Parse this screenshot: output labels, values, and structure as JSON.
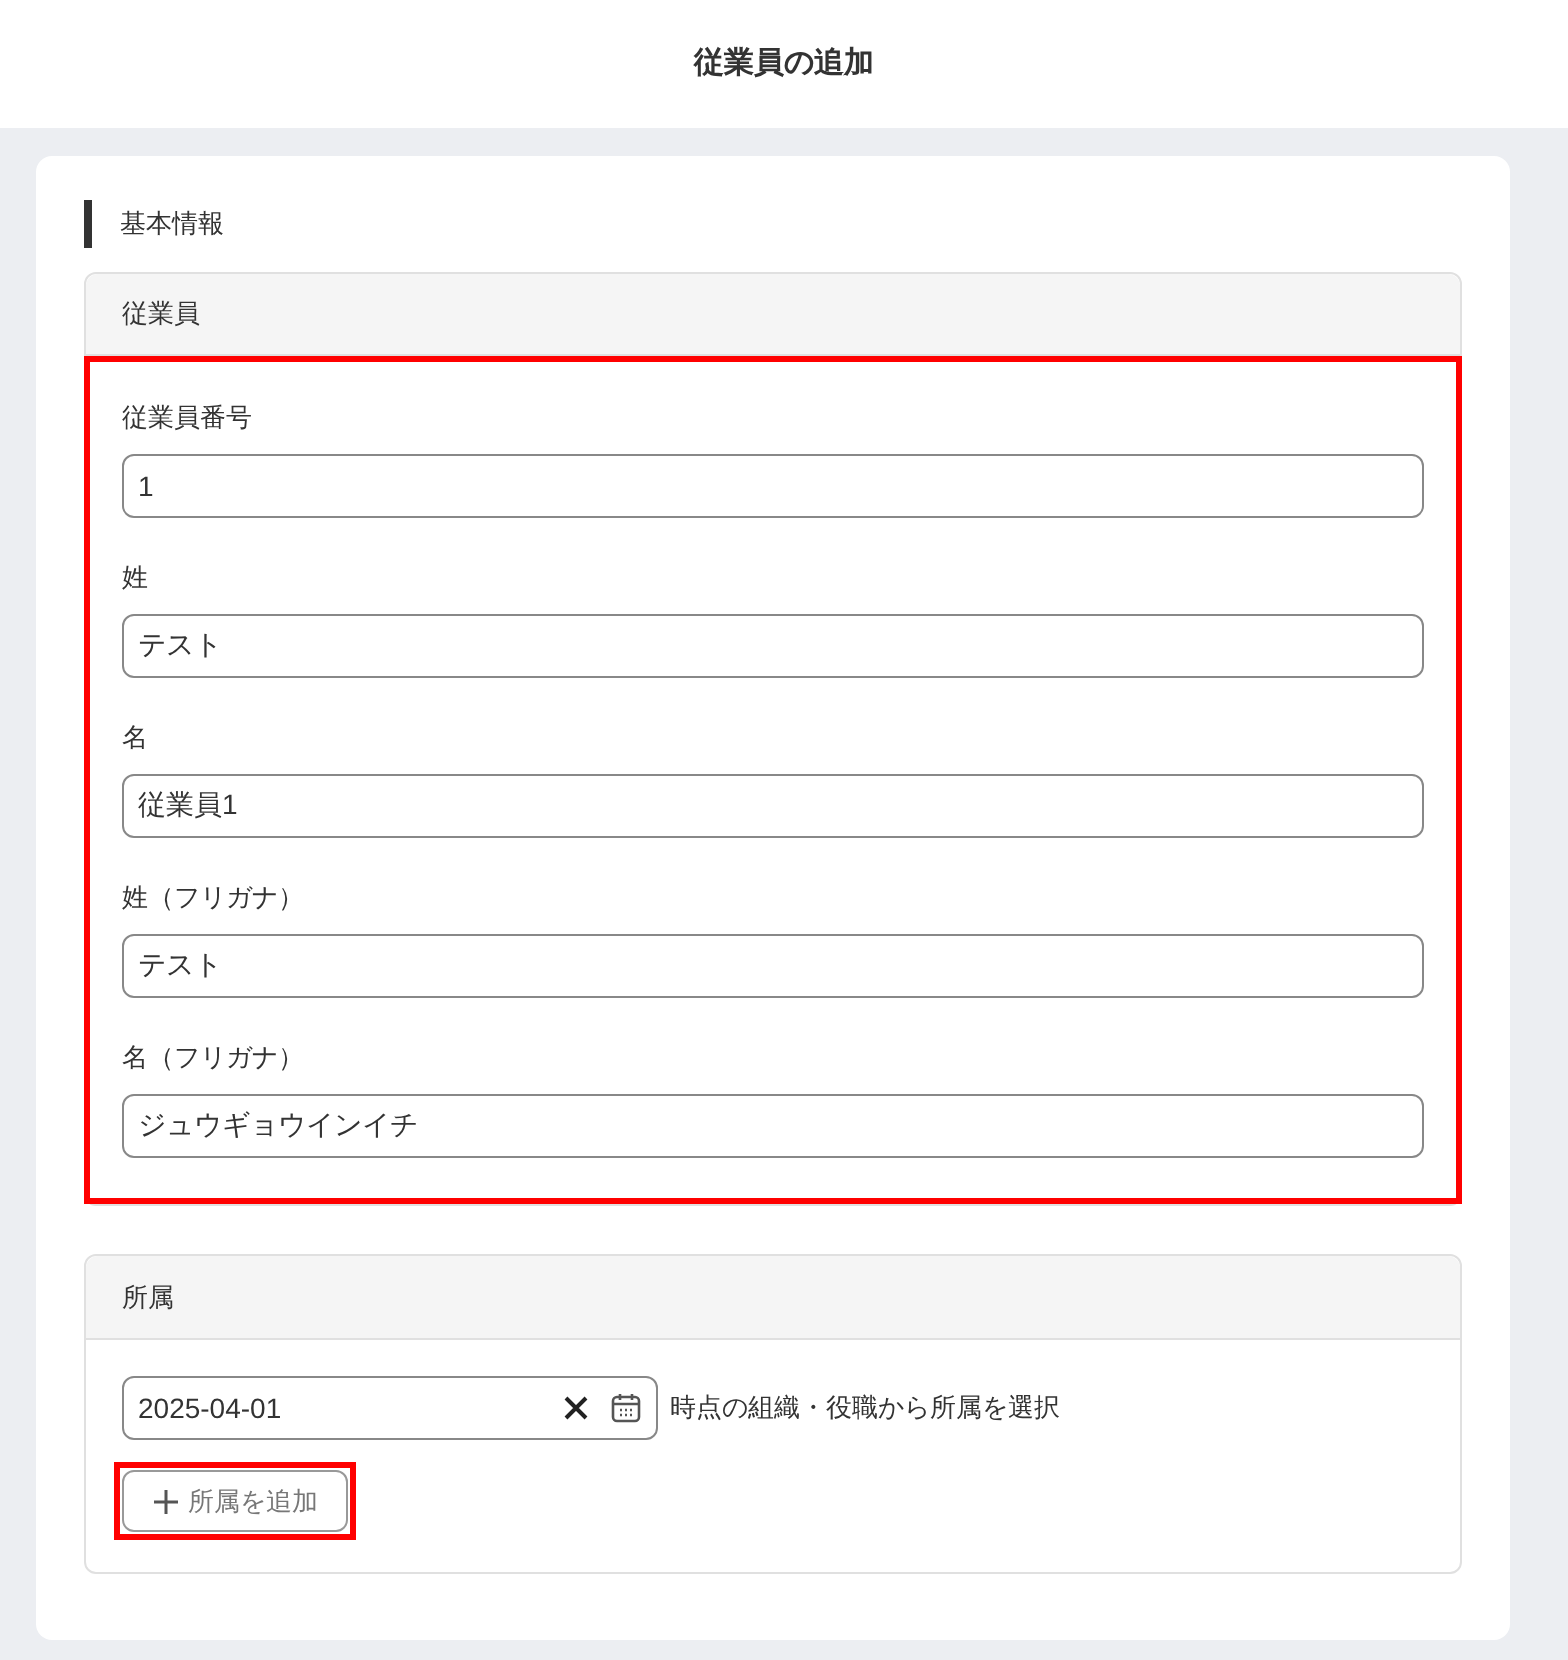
{
  "header": {
    "title": "従業員の追加"
  },
  "section": {
    "title": "基本情報"
  },
  "employee_panel": {
    "title": "従業員",
    "highlighted": true,
    "fields": [
      {
        "label": "従業員番号",
        "value": "1"
      },
      {
        "label": "姓",
        "value": "テスト"
      },
      {
        "label": "名",
        "value": "従業員1"
      },
      {
        "label": "姓（フリガナ）",
        "value": "テスト"
      },
      {
        "label": "名（フリガナ）",
        "value": "ジュウギョウインイチ"
      }
    ]
  },
  "affiliation_panel": {
    "title": "所属",
    "date": {
      "value": "2025-04-01"
    },
    "hint": "時点の組織・役職から所属を選択",
    "add_button": {
      "label": "所属を追加",
      "highlighted": true
    }
  }
}
